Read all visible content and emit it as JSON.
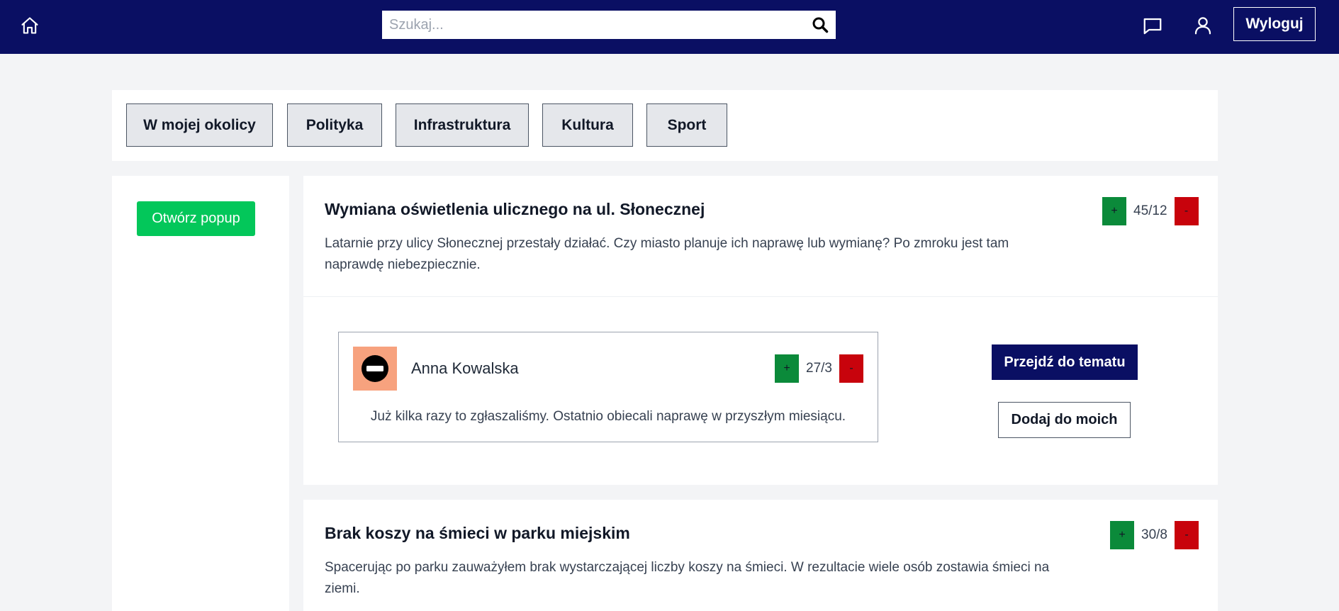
{
  "header": {
    "search_placeholder": "Szukaj...",
    "logout_label": "Wyloguj",
    "icons": [
      "home-icon",
      "search-icon",
      "chat-icon",
      "user-icon"
    ]
  },
  "categories": [
    "W mojej okolicy",
    "Polityka",
    "Infrastruktura",
    "Kultura",
    "Sport"
  ],
  "sidebar": {
    "popup_button": "Otwórz popup"
  },
  "posts": [
    {
      "title": "Wymiana oświetlenia ulicznego na ul. Słonecznej",
      "description": "Latarnie przy ulicy Słonecznej przestały działać. Czy miasto planuje ich naprawę lub wymianę? Po zmroku jest tam naprawdę niebezpiecznie.",
      "votes": "45/12",
      "comment": {
        "author": "Anna Kowalska",
        "text": "Już kilka razy to zgłaszaliśmy. Ostatnio obiecali naprawę w przyszłym miesiącu.",
        "votes": "27/3"
      },
      "goto_label": "Przejdź do tematu",
      "add_label": "Dodaj do moich"
    },
    {
      "title": "Brak koszy na śmieci w parku miejskim",
      "description": "Spacerując po parku zauważyłem brak wystarczającej liczby koszy na śmieci. W rezultacie wiele osób zostawia śmieci na ziemi.",
      "votes": "30/8"
    }
  ],
  "vote_labels": {
    "plus": "+",
    "minus": "-"
  },
  "colors": {
    "nav": "#0a0f63",
    "popup": "#03c75a",
    "upvote": "#0b8a3a",
    "downvote": "#c8030c",
    "avatar_bg": "#f7a27e"
  }
}
